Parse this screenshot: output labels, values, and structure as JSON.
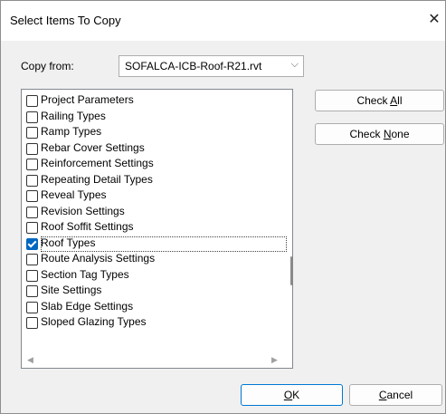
{
  "window": {
    "title": "Select Items To Copy",
    "close_glyph": "✕"
  },
  "copy_from": {
    "label": "Copy from:",
    "value": "SOFALCA-ICB-Roof-R21.rvt",
    "arrow_glyph": "⌵"
  },
  "list": {
    "items": [
      {
        "label": "Project Parameters",
        "checked": false
      },
      {
        "label": "Railing Types",
        "checked": false
      },
      {
        "label": "Ramp Types",
        "checked": false
      },
      {
        "label": "Rebar Cover Settings",
        "checked": false
      },
      {
        "label": "Reinforcement Settings",
        "checked": false
      },
      {
        "label": "Repeating Detail Types",
        "checked": false
      },
      {
        "label": "Reveal Types",
        "checked": false
      },
      {
        "label": "Revision Settings",
        "checked": false
      },
      {
        "label": "Roof Soffit Settings",
        "checked": false
      },
      {
        "label": "Roof Types",
        "checked": true,
        "focused": true
      },
      {
        "label": "Route Analysis Settings",
        "checked": false
      },
      {
        "label": "Section Tag Types",
        "checked": false
      },
      {
        "label": "Site Settings",
        "checked": false
      },
      {
        "label": "Slab Edge Settings",
        "checked": false
      },
      {
        "label": "Sloped Glazing Types",
        "checked": false
      }
    ],
    "scroll_left_glyph": "◀",
    "scroll_right_glyph": "▶"
  },
  "buttons": {
    "check_all": {
      "pre": "Check ",
      "accel": "A",
      "post": "ll"
    },
    "check_none": {
      "pre": "Check ",
      "accel": "N",
      "post": "one"
    },
    "ok": {
      "pre": "",
      "accel": "O",
      "post": "K"
    },
    "cancel": {
      "pre": "",
      "accel": "C",
      "post": "ancel"
    }
  }
}
